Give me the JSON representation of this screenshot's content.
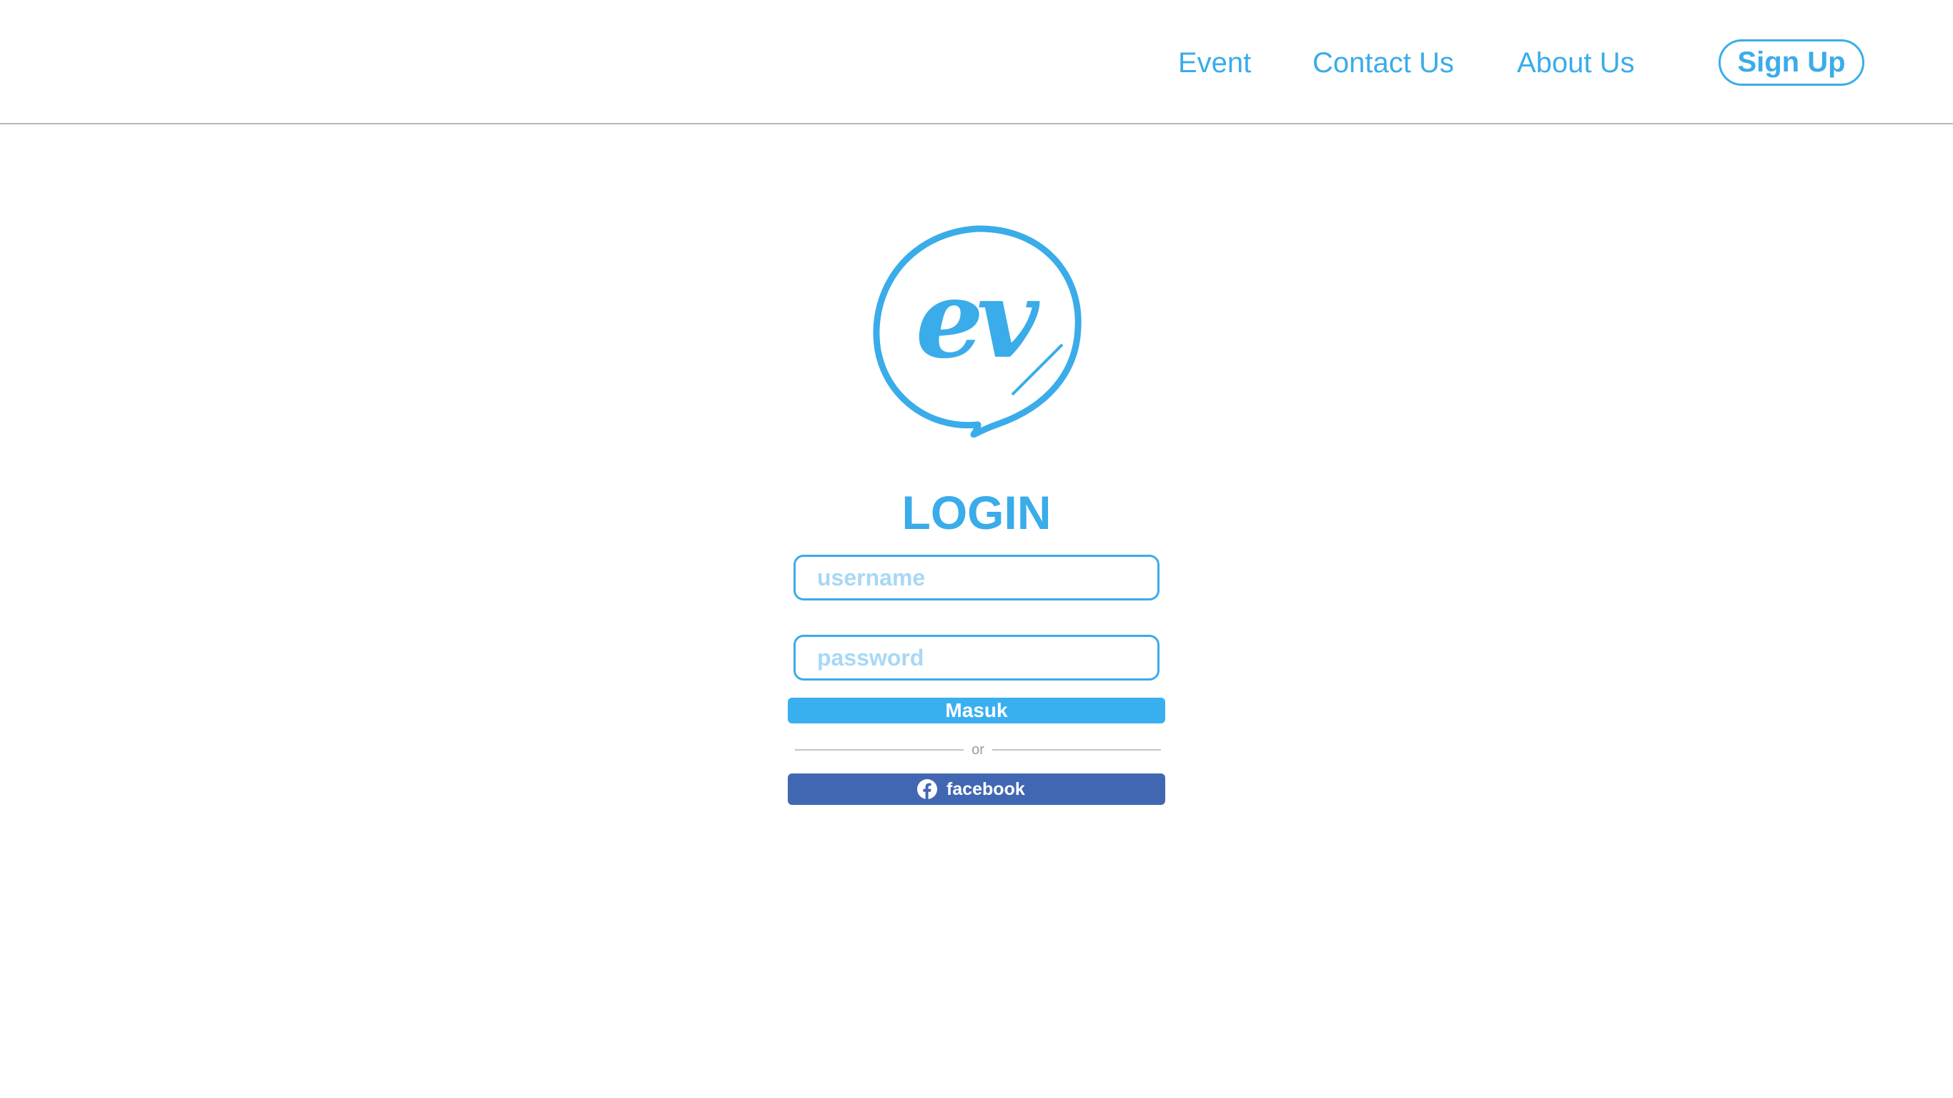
{
  "nav": {
    "event_label": "Event",
    "contact_label": "Contact Us",
    "about_label": "About Us",
    "signup_label": "Sign Up"
  },
  "logo": {
    "text": "ev",
    "icon": "ev-circle-logo"
  },
  "login": {
    "title": "LOGIN",
    "username_placeholder": "username",
    "password_placeholder": "password",
    "submit_label": "Masuk",
    "divider_text": "or",
    "facebook_label": "facebook",
    "facebook_icon": "facebook-icon"
  },
  "colors": {
    "accent": "#3aace9",
    "button": "#3aaff0",
    "facebook": "#4267b2",
    "placeholder": "#a8d8f4"
  }
}
